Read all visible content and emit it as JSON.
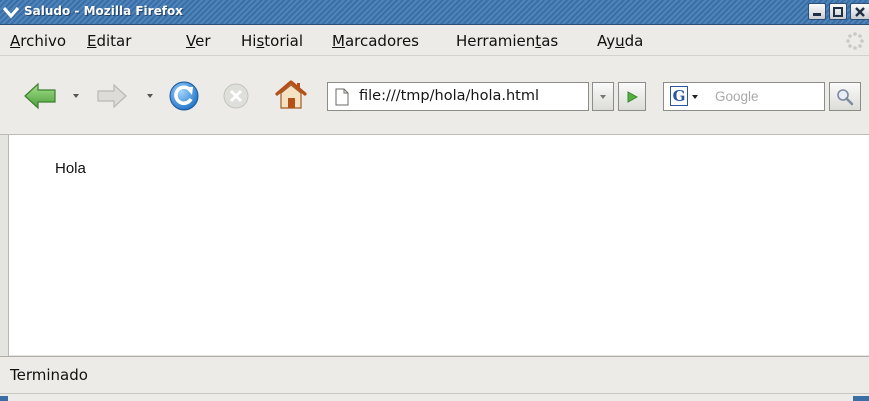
{
  "window": {
    "title": "Saludo - Mozilla Firefox"
  },
  "menubar": {
    "items": [
      {
        "label": "Archivo",
        "accel": "A",
        "rest": "rchivo"
      },
      {
        "label": "Editar",
        "accel": "E",
        "rest": "ditar"
      },
      {
        "label": "Ver",
        "accel": "V",
        "rest": "er"
      },
      {
        "label": "Historial",
        "pre": "Hi",
        "accel": "s",
        "rest": "torial"
      },
      {
        "label": "Marcadores",
        "accel": "M",
        "rest": "arcadores"
      },
      {
        "label": "Herramientas",
        "pre": "Herramien",
        "accel": "t",
        "rest": "as"
      },
      {
        "label": "Ayuda",
        "pre": "Ay",
        "accel": "u",
        "rest": "da"
      }
    ]
  },
  "navbar": {
    "icons": [
      "back-icon",
      "forward-icon",
      "reload-icon",
      "stop-icon",
      "home-icon"
    ],
    "url": "file:///tmp/hola/hola.html",
    "search_placeholder": "Google",
    "search_engine_letter": "G"
  },
  "content": {
    "text": "Hola"
  },
  "statusbar": {
    "text": "Terminado"
  },
  "colors": {
    "titlebar": "#3a6ea5",
    "chrome": "#ecebe7",
    "back_arrow": "#5bb04a",
    "reload": "#2e86d6",
    "home": "#c8641e"
  }
}
